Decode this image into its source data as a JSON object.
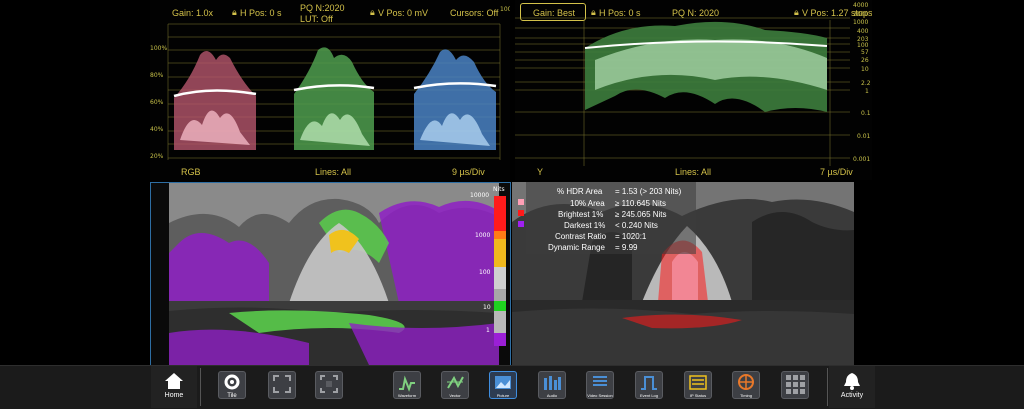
{
  "waveform": {
    "gain": "Gain: 1.0x",
    "hpos": "H Pos: 0 s",
    "pq": "PQ N:2020",
    "lut": "LUT: Off",
    "vpos": "V Pos: 0 mV",
    "cursors": "Cursors: Off",
    "corner_value": "100",
    "y_ticks": [
      "100%",
      "80%",
      "60%",
      "40%",
      "20%"
    ],
    "channels": "RGB",
    "lines": "Lines: All",
    "scale": "9 µs/Div",
    "colors": {
      "red": "#e58aa0",
      "green": "#7fd07f",
      "blue": "#6aa6e6",
      "grid": "#c9c24a"
    }
  },
  "stops_panel": {
    "gain_button": "Gain: Best",
    "hpos": "H Pos: 0 s",
    "pq": "PQ N: 2020",
    "vpos": "V Pos: 1.27 stops",
    "y_ticks": [
      "4000",
      "2000",
      "1000",
      "400",
      "203",
      "100",
      "57",
      "26",
      "10",
      "2.2",
      "1",
      "0.1",
      "0.01",
      "0.001"
    ],
    "channel": "Y",
    "lines": "Lines: All",
    "scale": "7 µs/Div"
  },
  "false_color": {
    "legend_title": "Nits",
    "legend_labels": [
      "10000",
      "1000",
      "100",
      "10",
      "1"
    ],
    "legend_colors": [
      "#ff1b1b",
      "#ff7b16",
      "#f0b81d",
      "#cfcfcf",
      "#a7a7a7",
      "#1fd31f",
      "#b8b8b8",
      "#9b1fd6"
    ],
    "marker_colors": [
      "#ff9fb6",
      "#ff1a1a",
      "#a020f0"
    ]
  },
  "hdr_stats": {
    "rows": [
      {
        "label": "% HDR Area",
        "value": "= 1.53 (> 203 Nits)"
      },
      {
        "label": "10% Area",
        "value": "≥ 110.645 Nits"
      },
      {
        "label": "Brightest 1%",
        "value": "≥ 245.065 Nits"
      },
      {
        "label": "Darkest 1%",
        "value": "< 0.240 Nits"
      },
      {
        "label": "Contrast Ratio",
        "value": "= 1020:1"
      },
      {
        "label": "Dynamic Range",
        "value": "= 9.99"
      }
    ]
  },
  "toolbar": {
    "home": "Home",
    "tile": "Tile",
    "waveform": "Waveform",
    "vector": "Vector",
    "picture": "Picture",
    "audio": "Audio",
    "video_session": "Video Session",
    "event_log": "Event Log",
    "ip_status": "IP Status",
    "timing": "Timing",
    "activity": "Activity"
  }
}
